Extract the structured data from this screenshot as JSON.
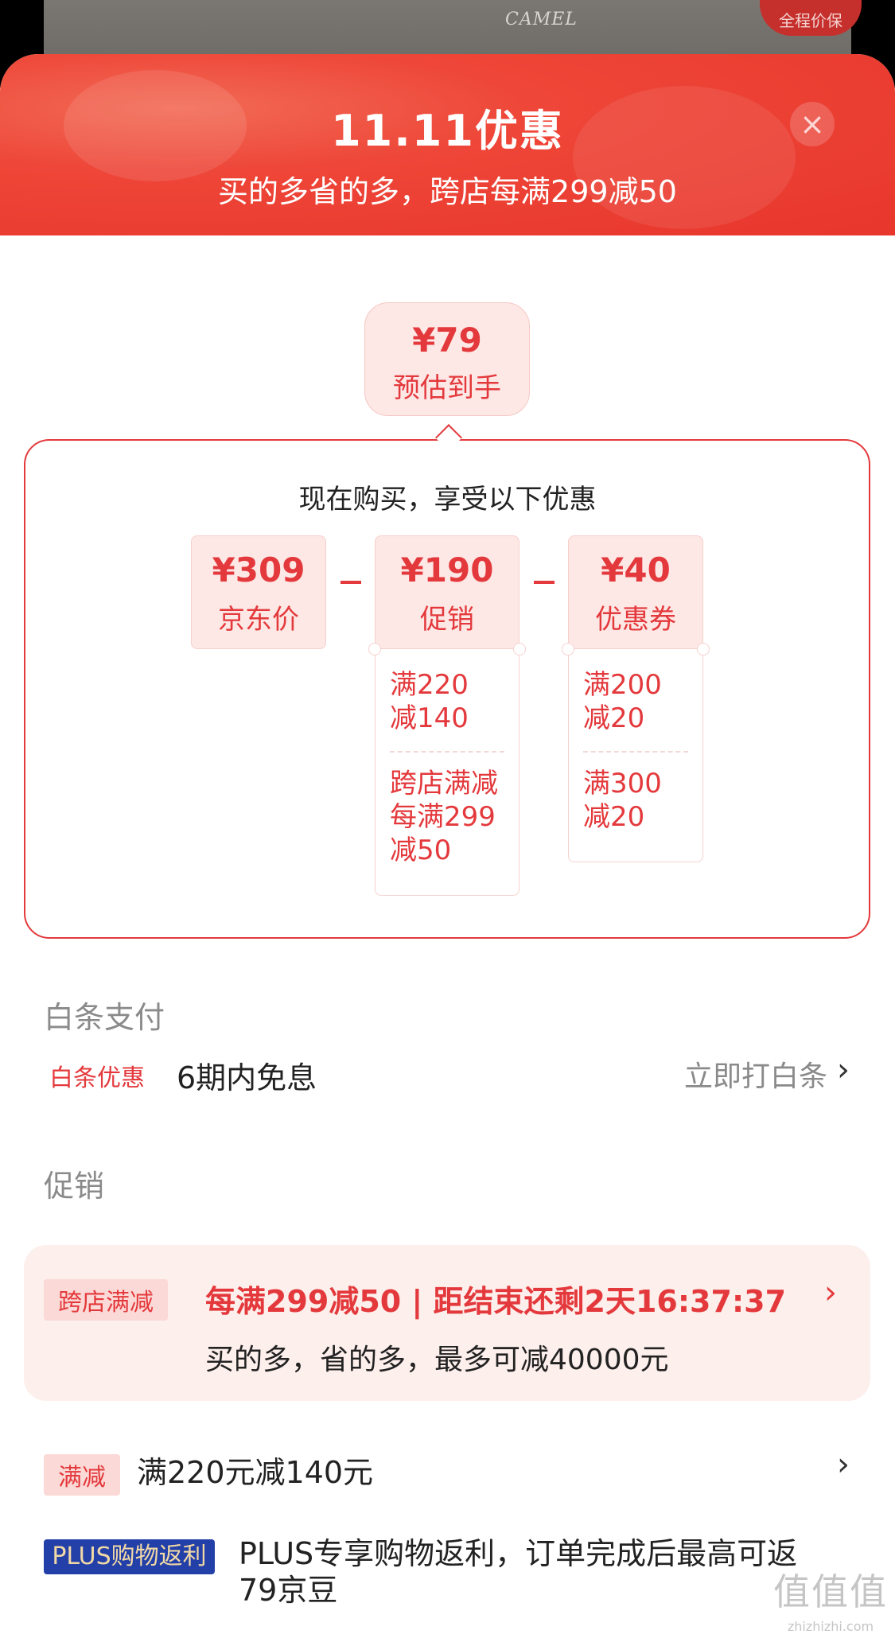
{
  "backdrop": {
    "brand_text": "CAMEL",
    "badge_text": "全程价保"
  },
  "header": {
    "title": "11.11优惠",
    "subtitle": "买的多省的多，跨店每满299减50",
    "close_icon": "close-icon"
  },
  "estimate": {
    "price": "¥79",
    "label": "预估到手"
  },
  "calc": {
    "title": "现在购买，享受以下优惠",
    "cards": [
      {
        "value": "¥309",
        "label": "京东价"
      },
      {
        "value": "¥190",
        "label": "促销"
      },
      {
        "value": "¥40",
        "label": "优惠券"
      }
    ],
    "operator": "−",
    "promo_details": [
      {
        "lines": [
          "满220",
          "减140"
        ]
      },
      {
        "lines": [
          "跨店满减",
          "每满299",
          "减50"
        ]
      }
    ],
    "coupon_details": [
      {
        "lines": [
          "满200",
          "减20"
        ]
      },
      {
        "lines": [
          "满300",
          "减20"
        ]
      }
    ]
  },
  "baitiao": {
    "section_title": "白条支付",
    "label": "白条优惠",
    "text": "6期内免息",
    "action": "立即打白条"
  },
  "promotions": {
    "section_title": "促销",
    "cross_store": {
      "tag": "跨店满减",
      "main": "每满299减50 | 距结束还剩2天16:37:37",
      "sub": "买的多，省的多，最多可减40000元"
    },
    "full_reduction": {
      "tag": "满减",
      "text": "满220元减140元"
    },
    "plus": {
      "tag": "PLUS购物返利",
      "text": "PLUS专享购物返利，订单完成后最高可返79京豆"
    }
  },
  "watermark": {
    "logo": "值值值",
    "url": "zhizhizhi.com"
  },
  "colors": {
    "accent": "#e4393c",
    "header_red": "#ee4638",
    "plus_blue": "#233fa8"
  }
}
